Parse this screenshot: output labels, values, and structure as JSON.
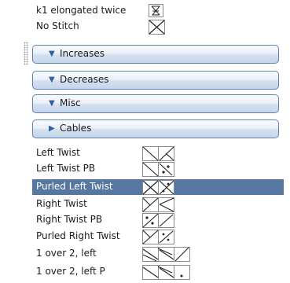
{
  "top_rows": [
    {
      "label": "k1 elongated twice"
    },
    {
      "label": "No Stitch"
    }
  ],
  "groups": [
    {
      "label": "Increases",
      "expanded": true
    },
    {
      "label": "Decreases",
      "expanded": true
    },
    {
      "label": "Misc",
      "expanded": true
    },
    {
      "label": "Cables",
      "expanded": false
    }
  ],
  "cable_rows": [
    {
      "label": "Left Twist",
      "selected": false
    },
    {
      "label": "Left Twist PB",
      "selected": false
    },
    {
      "label": "Purled Left Twist",
      "selected": true
    },
    {
      "label": "Right Twist",
      "selected": false
    },
    {
      "label": "Right Twist PB",
      "selected": false
    },
    {
      "label": "Purled Right Twist",
      "selected": false
    },
    {
      "label": "1 over 2, left",
      "selected": false
    },
    {
      "label": "1 over 2, left P",
      "selected": false
    }
  ],
  "icons": {
    "expanded": "▼",
    "collapsed": "▶"
  },
  "colors": {
    "selection": "#5777a0",
    "group_border": "#5c82b6"
  }
}
